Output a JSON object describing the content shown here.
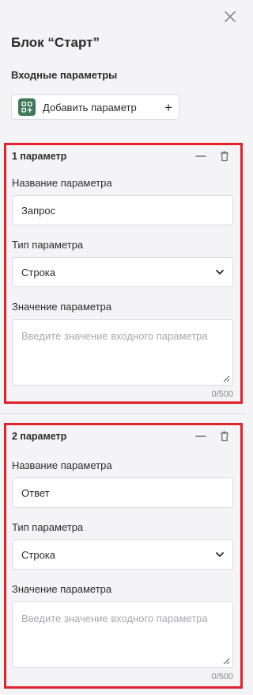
{
  "panel": {
    "title": "Блок “Старт”",
    "inputs_heading": "Входные параметры",
    "add_button_label": "Добавить параметр",
    "add_button_plus": "+"
  },
  "params": [
    {
      "title": "1 параметр",
      "name_label": "Название параметра",
      "name_value": "Запрос",
      "type_label": "Тип параметра",
      "type_value": "Строка",
      "value_label": "Значение параметра",
      "value_placeholder": "Введите значение входного параметра",
      "counter": "0/500"
    },
    {
      "title": "2 параметр",
      "name_label": "Название параметра",
      "name_value": "Ответ",
      "type_label": "Тип параметра",
      "type_value": "Строка",
      "value_label": "Значение параметра",
      "value_placeholder": "Введите значение входного параметра",
      "counter": "0/500"
    }
  ],
  "colors": {
    "highlight_border": "#e2222c",
    "add_icon_bg": "#3d7a59",
    "panel_bg": "#f4f4f6"
  },
  "icons": [
    "close-icon",
    "parameters-grid-icon",
    "plus-icon",
    "minimize-icon",
    "trash-icon",
    "chevron-down-icon",
    "resize-handle-icon"
  ]
}
